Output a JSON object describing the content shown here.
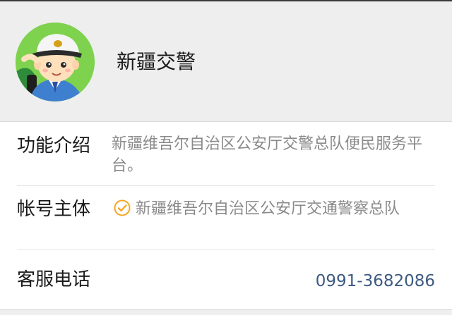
{
  "account": {
    "name": "新疆交警",
    "avatar_icon": "traffic-police-cartoon-icon"
  },
  "info": {
    "description_label": "功能介绍",
    "description_value": "新疆维吾尔自治区公安厅交警总队便民服务平台。",
    "entity_label": "帐号主体",
    "entity_value": "新疆维吾尔自治区公安厅交通警察总队",
    "entity_icon": "verified-check-icon",
    "phone_label": "客服电话",
    "phone_value": "0991-3682086"
  },
  "colors": {
    "verified_icon": "#f5a623",
    "phone_link": "#3d5a80",
    "avatar_bg": "#7ed24e"
  }
}
